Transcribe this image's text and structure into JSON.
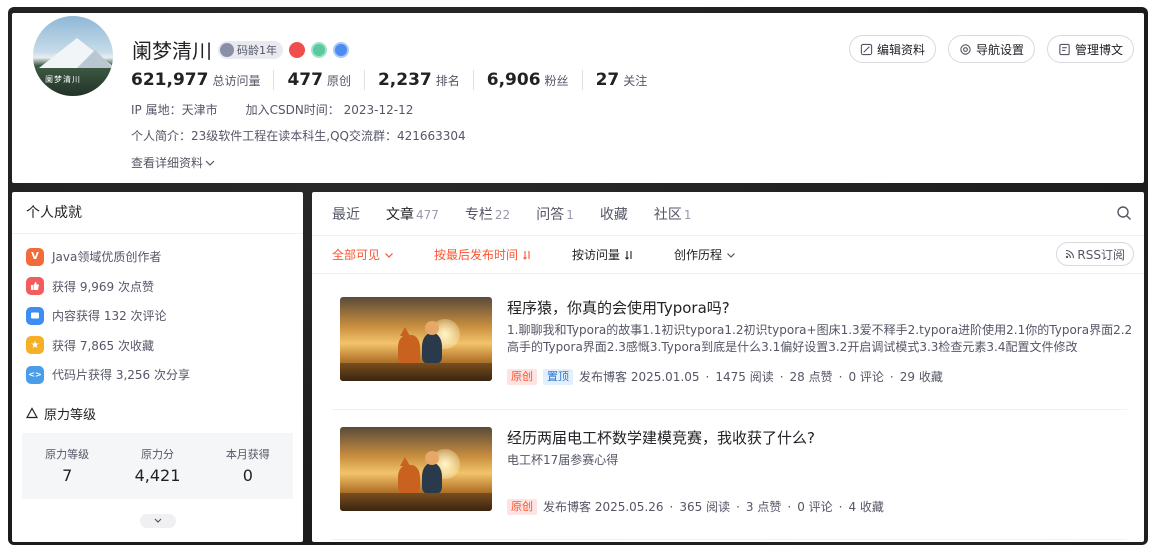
{
  "profile": {
    "username": "阑梦清川",
    "code_age": "码龄1年",
    "stats": [
      {
        "num": "621,977",
        "label": "总访问量"
      },
      {
        "num": "477",
        "label": "原创"
      },
      {
        "num": "2,237",
        "label": "排名"
      },
      {
        "num": "6,906",
        "label": "粉丝"
      },
      {
        "num": "27",
        "label": "关注"
      }
    ],
    "ip_location": "IP 属地：天津市",
    "join_time": "加入CSDN时间：  2023-12-12",
    "bio": "个人简介：23级软件工程在读本科生,QQ交流群：421663304",
    "detail_link": "查看详细资料",
    "avatar_text": "阑梦清川"
  },
  "header_buttons": {
    "edit": "编辑资料",
    "nav": "导航设置",
    "manage": "管理博文"
  },
  "achievements": {
    "title": "个人成就",
    "items": [
      {
        "text": "Java领域优质创作者",
        "icon": "V",
        "color": "#f26b3a"
      },
      {
        "text": "获得 9,969 次点赞",
        "icon": "👍",
        "color": "#f25c5c"
      },
      {
        "text": "内容获得 132 次评论",
        "icon": "▪",
        "color": "#3d8ef0"
      },
      {
        "text": "获得 7,865 次收藏",
        "icon": "★",
        "color": "#f5b025"
      },
      {
        "text": "代码片获得 3,256 次分享",
        "icon": "<>",
        "color": "#4a9de8"
      }
    ],
    "level_title": "原力等级",
    "level": {
      "level_label": "原力等级",
      "level_value": "7",
      "score_label": "原力分",
      "score_value": "4,421",
      "month_label": "本月获得",
      "month_value": "0"
    }
  },
  "tabs": [
    {
      "label": "最近",
      "count": ""
    },
    {
      "label": "文章",
      "count": "477"
    },
    {
      "label": "专栏",
      "count": "22"
    },
    {
      "label": "问答",
      "count": "1"
    },
    {
      "label": "收藏",
      "count": ""
    },
    {
      "label": "社区",
      "count": "1"
    }
  ],
  "filters": {
    "visibility": "全部可见",
    "sort_time": "按最后发布时间",
    "sort_views": "按访问量",
    "history": "创作历程",
    "rss": "RSS订阅"
  },
  "articles": [
    {
      "title": "程序猿，你真的会使用Typora吗?",
      "desc": "1.聊聊我和Typora的故事1.1初识typora1.2初识typora+图床1.3爱不释手2.typora进阶使用2.1你的Typora界面2.2高手的Typora界面2.3感慨3.Typora到底是什么3.1偏好设置3.2开启调试模式3.3检查元素3.4配置文件修改",
      "tag_orig": "原创",
      "tag_top": "置顶",
      "published": "发布博客 2025.01.05",
      "reads": "1475 阅读",
      "likes": "28 点赞",
      "comments": "0 评论",
      "favs": "29 收藏"
    },
    {
      "title": "经历两届电工杯数学建模竞赛，我收获了什么?",
      "desc": "电工杯17届参赛心得",
      "tag_orig": "原创",
      "published": "发布博客 2025.05.26",
      "reads": "365 阅读",
      "likes": "3 点赞",
      "comments": "0 评论",
      "favs": "4 收藏"
    }
  ]
}
